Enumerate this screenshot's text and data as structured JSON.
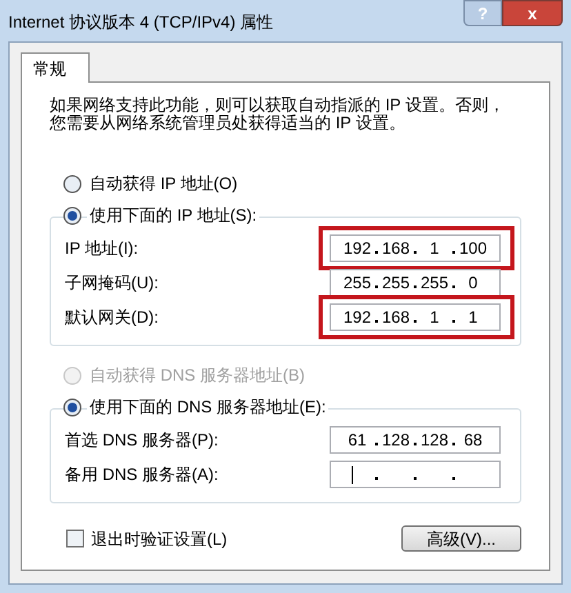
{
  "window": {
    "title": "Internet 协议版本 4 (TCP/IPv4) 属性",
    "help_button": "?",
    "close_button": "x"
  },
  "tabs": [
    {
      "label": "常规",
      "selected": true
    }
  ],
  "description": "如果网络支持此功能，则可以获取自动指派的 IP 设置。否则，您需要从网络系统管理员处获得适当的 IP 设置。",
  "ip_options": [
    {
      "label": "自动获得 IP 地址(O)",
      "selected": false,
      "disabled": false
    },
    {
      "label": "使用下面的 IP 地址(S):",
      "selected": true,
      "disabled": false
    }
  ],
  "ip_fields": [
    {
      "label": "IP 地址(I):",
      "octets": [
        "192",
        "168",
        "1",
        "100"
      ],
      "highlighted": true,
      "focused": false
    },
    {
      "label": "子网掩码(U):",
      "octets": [
        "255",
        "255",
        "255",
        "0"
      ],
      "highlighted": false,
      "focused": false
    },
    {
      "label": "默认网关(D):",
      "octets": [
        "192",
        "168",
        "1",
        "1"
      ],
      "highlighted": true,
      "focused": false
    }
  ],
  "dns_options": [
    {
      "label": "自动获得 DNS 服务器地址(B)",
      "selected": false,
      "disabled": true
    },
    {
      "label": "使用下面的 DNS 服务器地址(E):",
      "selected": true,
      "disabled": false
    }
  ],
  "dns_fields": [
    {
      "label": "首选 DNS 服务器(P):",
      "octets": [
        "61",
        "128",
        "128",
        "68"
      ],
      "highlighted": false,
      "focused": false
    },
    {
      "label": "备用 DNS 服务器(A):",
      "highlighted": false,
      "focused": true
    }
  ],
  "validate_on_exit": {
    "label": "退出时验证设置(L)",
    "checked": false
  },
  "advanced_button": "高级(V)..."
}
